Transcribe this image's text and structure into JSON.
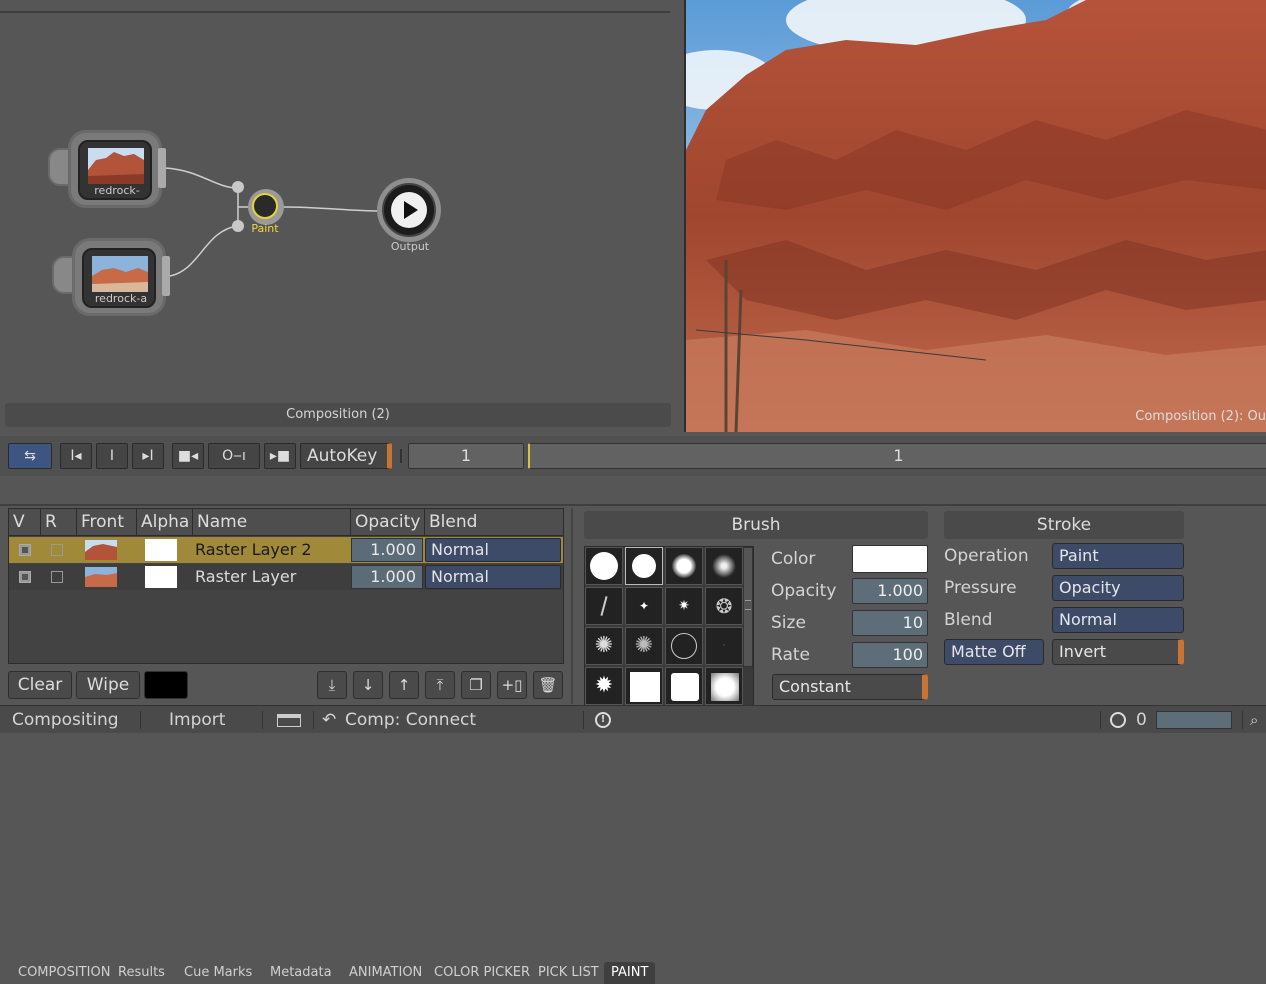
{
  "node_editor": {
    "nodes": [
      {
        "name": "redrock-"
      },
      {
        "name": "redrock-a"
      },
      {
        "name": "Paint"
      },
      {
        "name": "Output"
      }
    ],
    "label": "Composition (2)"
  },
  "viewer": {
    "label": "Composition (2): Ou"
  },
  "transport": {
    "autokey_label": "AutoKey",
    "frame_field": "1",
    "timeline_value": "1"
  },
  "tabs": [
    "COMPOSITION",
    "Results",
    "Cue Marks",
    "Metadata",
    "ANIMATION",
    "COLOR PICKER",
    "PICK LIST",
    "PAINT"
  ],
  "active_tab": "PAINT",
  "layer_table": {
    "headers": [
      "V",
      "R",
      "Front",
      "Alpha",
      "Name",
      "Opacity",
      "Blend"
    ],
    "rows": [
      {
        "name": "Raster Layer 2",
        "opacity": "1.000",
        "blend": "Normal",
        "v": true,
        "r": false,
        "selected": true
      },
      {
        "name": "Raster Layer",
        "opacity": "1.000",
        "blend": "Normal",
        "v": true,
        "r": false,
        "selected": false
      }
    ]
  },
  "layer_buttons": {
    "clear": "Clear",
    "wipe": "Wipe"
  },
  "brush": {
    "title": "Brush",
    "color_label": "Color",
    "opacity_label": "Opacity",
    "opacity_value": "1.000",
    "size_label": "Size",
    "size_value": "10",
    "rate_label": "Rate",
    "rate_value": "100",
    "mode": "Constant"
  },
  "stroke": {
    "title": "Stroke",
    "operation_label": "Operation",
    "operation_value": "Paint",
    "pressure_label": "Pressure",
    "pressure_value": "Opacity",
    "blend_label": "Blend",
    "blend_value": "Normal",
    "matte_button": "Matte Off",
    "invert_button": "Invert"
  },
  "status_bar": {
    "compositing": "Compositing",
    "import": "Import",
    "comp_connect": "Comp: Connect",
    "counter": "0"
  },
  "colors": {
    "selected_row": "#a08a3a",
    "accent_blue": "#3d4a68",
    "paint_ring": "#e8d23a"
  }
}
